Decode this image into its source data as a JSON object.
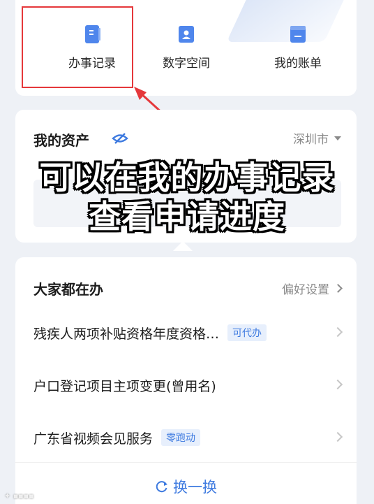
{
  "shortcuts": [
    {
      "label": "办事记录",
      "icon": "document-icon"
    },
    {
      "label": "数字空间",
      "icon": "id-card-icon"
    },
    {
      "label": "我的账单",
      "icon": "bill-icon"
    }
  ],
  "assets": {
    "title": "我的资产",
    "city": "深圳市"
  },
  "overlay": {
    "line1": "可以在我的办事记录",
    "line2": "查看申请进度"
  },
  "todo": {
    "title": "大家都在办",
    "prefs_label": "偏好设置",
    "items": [
      {
        "text": "残疾人两项补贴资格年度资格…",
        "badge": "可代办"
      },
      {
        "text": "户口登记项目主项变更(曾用名)",
        "badge": ""
      },
      {
        "text": "广东省视频会见服务",
        "badge": "零跑动"
      }
    ],
    "refresh_label": "换一换"
  },
  "colors": {
    "accent": "#3f7be0",
    "highlight": "#e5383b"
  }
}
